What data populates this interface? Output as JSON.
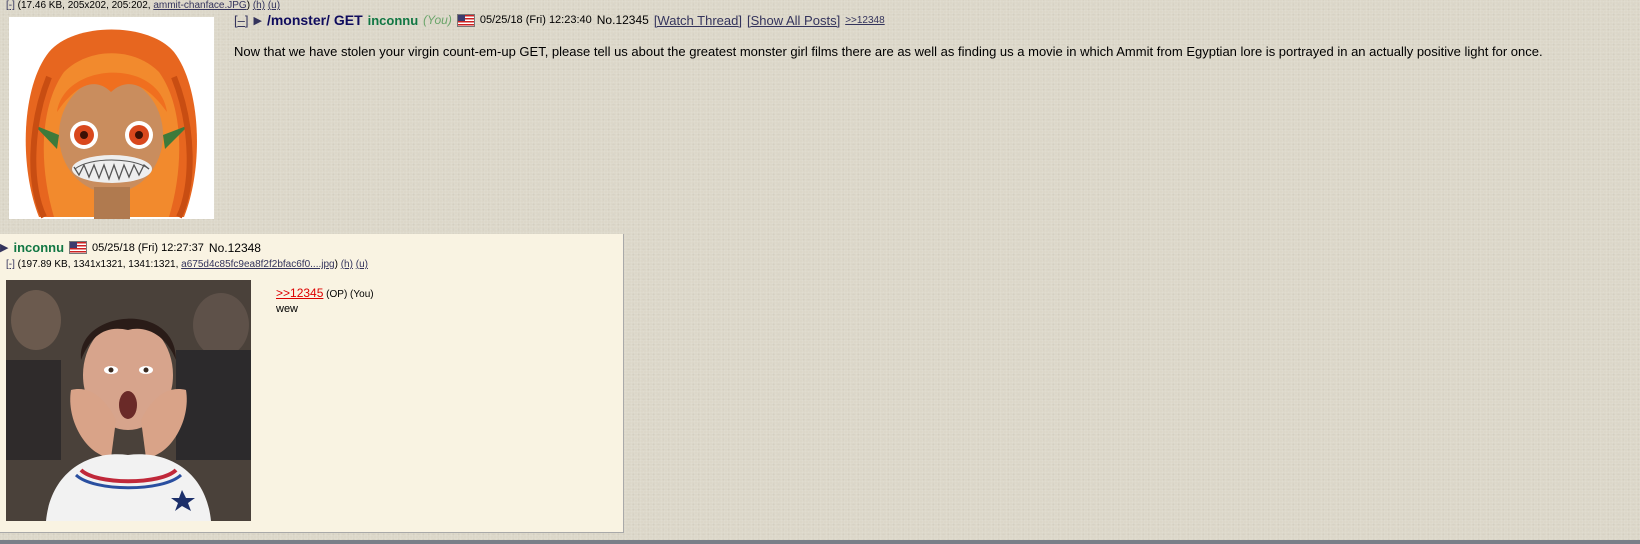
{
  "op": {
    "file": {
      "toggle": "[-]",
      "meta": " (17.46 KB, 205x202, 205:202, ",
      "filename": "ammit-chanface.JPG",
      "close": ") ",
      "h": "(h)",
      "u": "(u)"
    },
    "hide_button": "[–]",
    "expand_icon": "triangle-right-icon",
    "subject": "/monster/ GET",
    "name": "inconnu",
    "you": "(You)",
    "flag": "us-flag-icon",
    "datetime": "05/25/18 (Fri) 12:23:40",
    "post_no": "No.12345",
    "watch_thread": "[Watch Thread]",
    "show_all_posts": "[Show All Posts]",
    "backlink": ">>12348",
    "message": "Now that we have stolen your virgin count-em-up GET, please tell us about the greatest monster girl films there are as well as finding us a movie in which Ammit from Egyptian lore is portrayed in an actually positive light for once."
  },
  "reply": {
    "name": "inconnu",
    "flag": "us-flag-icon",
    "datetime": "05/25/18 (Fri) 12:27:37",
    "post_no": "No.12348",
    "file": {
      "toggle": "[-]",
      "meta": " (197.89 KB, 1341x1321, 1341:1321, ",
      "filename": "a675d4c85fc9ea8f2f2bfac6f0....jpg",
      "close": ") ",
      "h": "(h)",
      "u": "(u)"
    },
    "quotelink": ">>12345",
    "quote_suffix": " (OP) (You)",
    "text": "wew"
  },
  "colors": {
    "page_bg": "#dcd7c9",
    "reply_bg": "#f9f3e2",
    "subject": "#0f0c5d",
    "name": "#117743",
    "link": "#34345c",
    "quotelink": "#dd0000"
  }
}
